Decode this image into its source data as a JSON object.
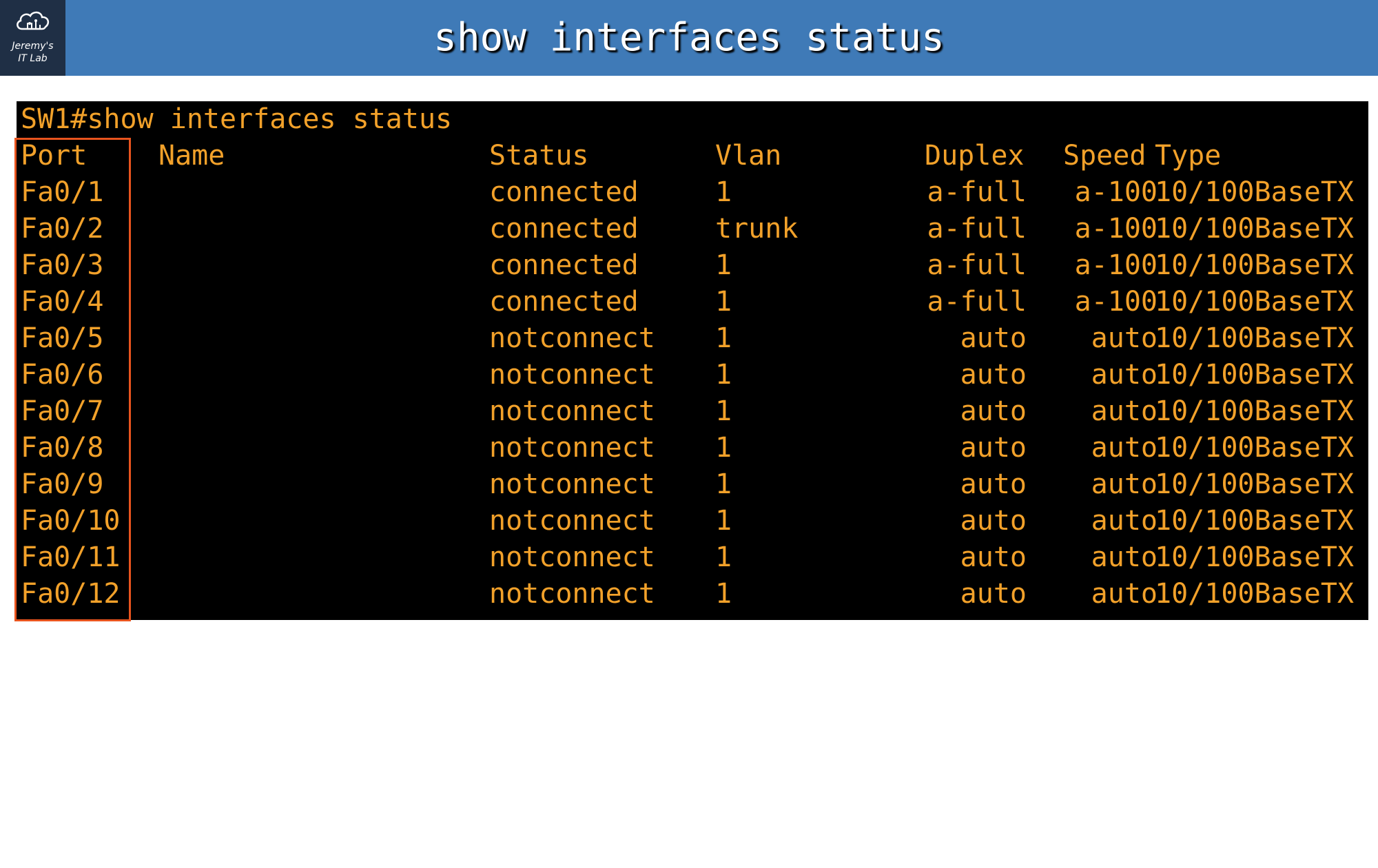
{
  "header": {
    "title": "show interfaces status",
    "logo_line1": "Jeremy's",
    "logo_line2": "IT Lab"
  },
  "terminal": {
    "command": "SW1#show interfaces status",
    "columns": {
      "port": "Port",
      "name": "Name",
      "status": "Status",
      "vlan": "Vlan",
      "duplex": "Duplex",
      "speed": "Speed",
      "type": "Type"
    },
    "rows": [
      {
        "port": "Fa0/1",
        "name": "",
        "status": "connected",
        "vlan": "1",
        "duplex": "a-full",
        "speed": "a-100",
        "type": "10/100BaseTX"
      },
      {
        "port": "Fa0/2",
        "name": "",
        "status": "connected",
        "vlan": "trunk",
        "duplex": "a-full",
        "speed": "a-100",
        "type": "10/100BaseTX"
      },
      {
        "port": "Fa0/3",
        "name": "",
        "status": "connected",
        "vlan": "1",
        "duplex": "a-full",
        "speed": "a-100",
        "type": "10/100BaseTX"
      },
      {
        "port": "Fa0/4",
        "name": "",
        "status": "connected",
        "vlan": "1",
        "duplex": "a-full",
        "speed": "a-100",
        "type": "10/100BaseTX"
      },
      {
        "port": "Fa0/5",
        "name": "",
        "status": "notconnect",
        "vlan": "1",
        "duplex": "auto",
        "speed": "auto",
        "type": "10/100BaseTX"
      },
      {
        "port": "Fa0/6",
        "name": "",
        "status": "notconnect",
        "vlan": "1",
        "duplex": "auto",
        "speed": "auto",
        "type": "10/100BaseTX"
      },
      {
        "port": "Fa0/7",
        "name": "",
        "status": "notconnect",
        "vlan": "1",
        "duplex": "auto",
        "speed": "auto",
        "type": "10/100BaseTX"
      },
      {
        "port": "Fa0/8",
        "name": "",
        "status": "notconnect",
        "vlan": "1",
        "duplex": "auto",
        "speed": "auto",
        "type": "10/100BaseTX"
      },
      {
        "port": "Fa0/9",
        "name": "",
        "status": "notconnect",
        "vlan": "1",
        "duplex": "auto",
        "speed": "auto",
        "type": "10/100BaseTX"
      },
      {
        "port": "Fa0/10",
        "name": "",
        "status": "notconnect",
        "vlan": "1",
        "duplex": "auto",
        "speed": "auto",
        "type": "10/100BaseTX"
      },
      {
        "port": "Fa0/11",
        "name": "",
        "status": "notconnect",
        "vlan": "1",
        "duplex": "auto",
        "speed": "auto",
        "type": "10/100BaseTX"
      },
      {
        "port": "Fa0/12",
        "name": "",
        "status": "notconnect",
        "vlan": "1",
        "duplex": "auto",
        "speed": "auto",
        "type": "10/100BaseTX"
      }
    ]
  },
  "colors": {
    "header_bg": "#3f7ab7",
    "terminal_bg": "#000000",
    "terminal_text": "#f2a12a",
    "highlight_border": "#e8541e"
  }
}
